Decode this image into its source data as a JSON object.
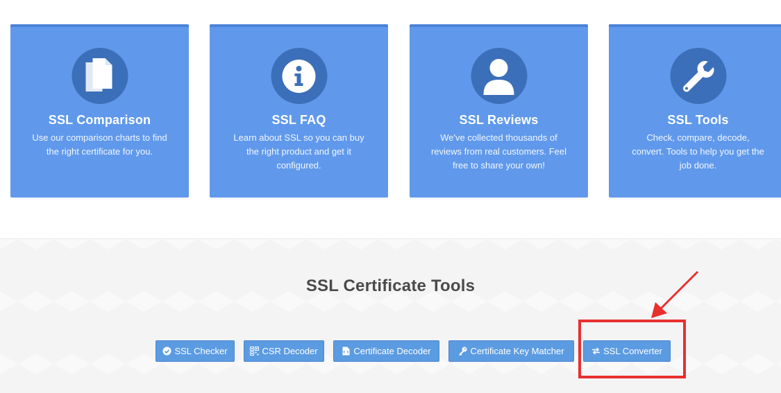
{
  "cards": [
    {
      "title": "SSL Comparison",
      "desc": "Use our comparison charts to find the right certificate for you.",
      "icon": "documents-icon"
    },
    {
      "title": "SSL FAQ",
      "desc": "Learn about SSL so you can buy the right product and get it configured.",
      "icon": "info-icon"
    },
    {
      "title": "SSL Reviews",
      "desc": "We've collected thousands of reviews from real customers. Feel free to share your own!",
      "icon": "user-icon"
    },
    {
      "title": "SSL Tools",
      "desc": "Check, compare, decode, convert. Tools to help you get the job done.",
      "icon": "wrench-icon"
    }
  ],
  "tools": {
    "title": "SSL Certificate Tools",
    "buttons": [
      {
        "label": "SSL Checker",
        "icon": "check-circle-icon"
      },
      {
        "label": "CSR Decoder",
        "icon": "qrcode-icon"
      },
      {
        "label": "Certificate Decoder",
        "icon": "file-code-icon"
      },
      {
        "label": "Certificate Key Matcher",
        "icon": "key-icon"
      },
      {
        "label": "SSL Converter",
        "icon": "exchange-icon"
      }
    ]
  },
  "colors": {
    "card_bg": "#6099eb",
    "icon_circle": "#3c6fb9",
    "button_bg": "#5b9be2",
    "annotation_red": "#e8302f"
  }
}
